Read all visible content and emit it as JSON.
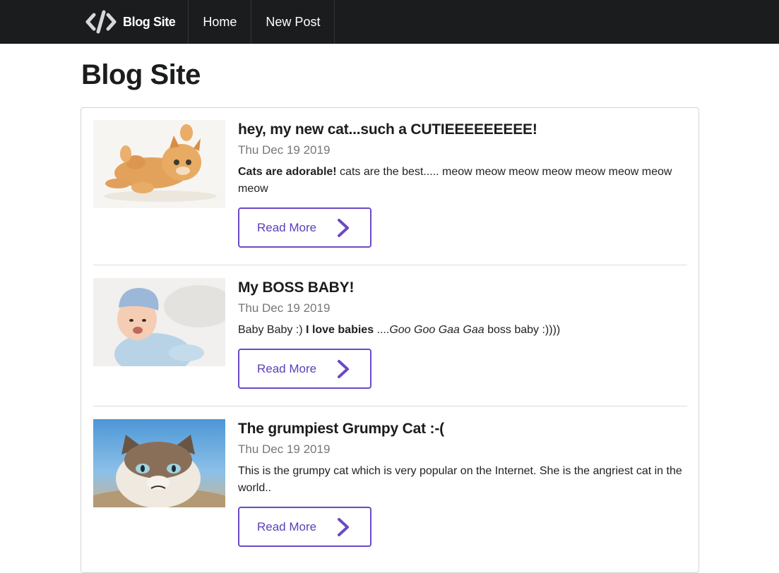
{
  "navbar": {
    "brand_label": "Blog Site",
    "brand_icon": "code-icon",
    "items": [
      {
        "label": "Home"
      },
      {
        "label": "New Post"
      }
    ]
  },
  "page": {
    "title": "Blog Site"
  },
  "posts": [
    {
      "title": "hey, my new cat...such a CUTIEEEEEEEEE!",
      "date": "Thu Dec 19 2019",
      "body_bold": "Cats are adorable!",
      "body_rest": " cats are the best..... meow meow meow meow meow meow meow meow",
      "read_more": "Read More",
      "thumb_alt": "kitten"
    },
    {
      "title": "My BOSS BABY!",
      "date": "Thu Dec 19 2019",
      "body_pre": "Baby Baby :) ",
      "body_bold": "I love babies",
      "body_mid": " ....",
      "body_italic": "Goo Goo Gaa Gaa",
      "body_post": " boss baby :))))",
      "read_more": "Read More",
      "thumb_alt": "baby"
    },
    {
      "title": "The grumpiest Grumpy Cat :-(",
      "date": "Thu Dec 19 2019",
      "body": "This is the grumpy cat which is very popular on the Internet. She is the angriest cat in the world..",
      "read_more": "Read More",
      "thumb_alt": "grumpy cat"
    }
  ],
  "colors": {
    "navbar_bg": "#1b1c1d",
    "accent": "#6c4ac4",
    "date_text": "#777777"
  }
}
